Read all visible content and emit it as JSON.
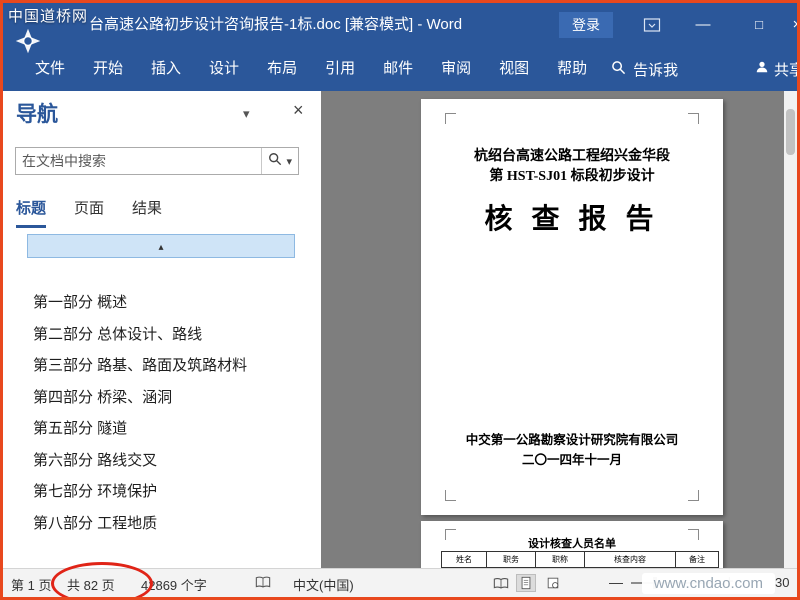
{
  "window": {
    "title": "台高速公路初步设计咨询报告-1标.doc [兼容模式] -  Word",
    "sign_in_label": "登录"
  },
  "icons": {
    "dropdown_caret": "▾",
    "close": "×",
    "minimize": "—",
    "maximize": "□",
    "triangle_up": "▴",
    "zoom_out": "—",
    "zoom_in": "+"
  },
  "watermarks": {
    "top_left": "中国道桥网",
    "bottom_right": "www.cndao.com"
  },
  "ribbon": {
    "tabs": [
      {
        "label": "文件"
      },
      {
        "label": "开始"
      },
      {
        "label": "插入"
      },
      {
        "label": "设计"
      },
      {
        "label": "布局"
      },
      {
        "label": "引用"
      },
      {
        "label": "邮件"
      },
      {
        "label": "审阅"
      },
      {
        "label": "视图"
      },
      {
        "label": "帮助"
      }
    ],
    "tell_me_label": "告诉我",
    "share_label": "共享"
  },
  "nav_pane": {
    "title": "导航",
    "search_placeholder": "在文档中搜索",
    "tabs": [
      {
        "label": "标题"
      },
      {
        "label": "页面"
      },
      {
        "label": "结果"
      }
    ],
    "headings": [
      "第一部分 概述",
      "第二部分 总体设计、路线",
      "第三部分 路基、路面及筑路材料",
      "第四部分 桥梁、涵洞",
      "第五部分 隧道",
      "第六部分 路线交叉",
      "第七部分 环境保护",
      "第八部分 工程地质"
    ]
  },
  "document": {
    "page1": {
      "subtitle_line1": "杭绍台高速公路工程绍兴金华段",
      "subtitle_line2": "第 HST-SJ01 标段初步设计",
      "title": "核 查 报 告",
      "company": "中交第一公路勘察设计研究院有限公司",
      "date": "二〇一四年十一月"
    },
    "page2": {
      "table_title": "设计核查人员名单",
      "table_headers": [
        "姓名",
        "职务",
        "职称",
        "核查内容",
        "备注"
      ]
    }
  },
  "status_bar": {
    "page_indicator": "第 1 页",
    "page_total": "共 82 页",
    "word_count": "42869 个字",
    "language": "中文(中国)",
    "zoom_percent": "30"
  }
}
